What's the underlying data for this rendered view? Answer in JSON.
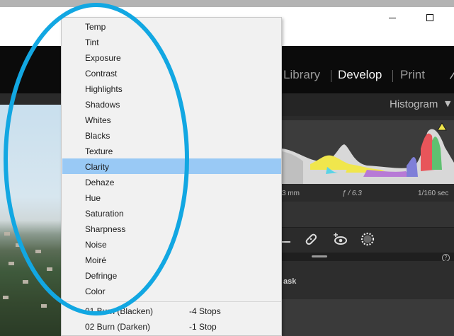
{
  "window": {
    "minimize_icon": "minimize-icon",
    "maximize_icon": "maximize-icon"
  },
  "modules": {
    "library": "Library",
    "develop": "Develop",
    "print": "Print"
  },
  "histogram": {
    "title": "Histogram",
    "focal_length": "3 mm",
    "aperture": "ƒ / 6.3",
    "shutter": "1/160 sec"
  },
  "masking": {
    "label": "ask"
  },
  "context_menu": {
    "items": [
      {
        "label": "Temp",
        "selected": false
      },
      {
        "label": "Tint",
        "selected": false
      },
      {
        "label": "Exposure",
        "selected": false
      },
      {
        "label": "Contrast",
        "selected": false
      },
      {
        "label": "Highlights",
        "selected": false
      },
      {
        "label": "Shadows",
        "selected": false
      },
      {
        "label": "Whites",
        "selected": false
      },
      {
        "label": "Blacks",
        "selected": false
      },
      {
        "label": "Texture",
        "selected": false
      },
      {
        "label": "Clarity",
        "selected": true
      },
      {
        "label": "Dehaze",
        "selected": false
      },
      {
        "label": "Hue",
        "selected": false
      },
      {
        "label": "Saturation",
        "selected": false
      },
      {
        "label": "Sharpness",
        "selected": false
      },
      {
        "label": "Noise",
        "selected": false
      },
      {
        "label": "Moiré",
        "selected": false
      },
      {
        "label": "Defringe",
        "selected": false
      },
      {
        "label": "Color",
        "selected": false
      }
    ],
    "presets": [
      {
        "label": "01 Burn (Blacken)",
        "amount": "-4 Stops"
      },
      {
        "label": "02 Burn (Darken)",
        "amount": "-1 Stop"
      }
    ]
  },
  "colors": {
    "annotation": "#12a7e2",
    "selection": "#99c9f5"
  }
}
